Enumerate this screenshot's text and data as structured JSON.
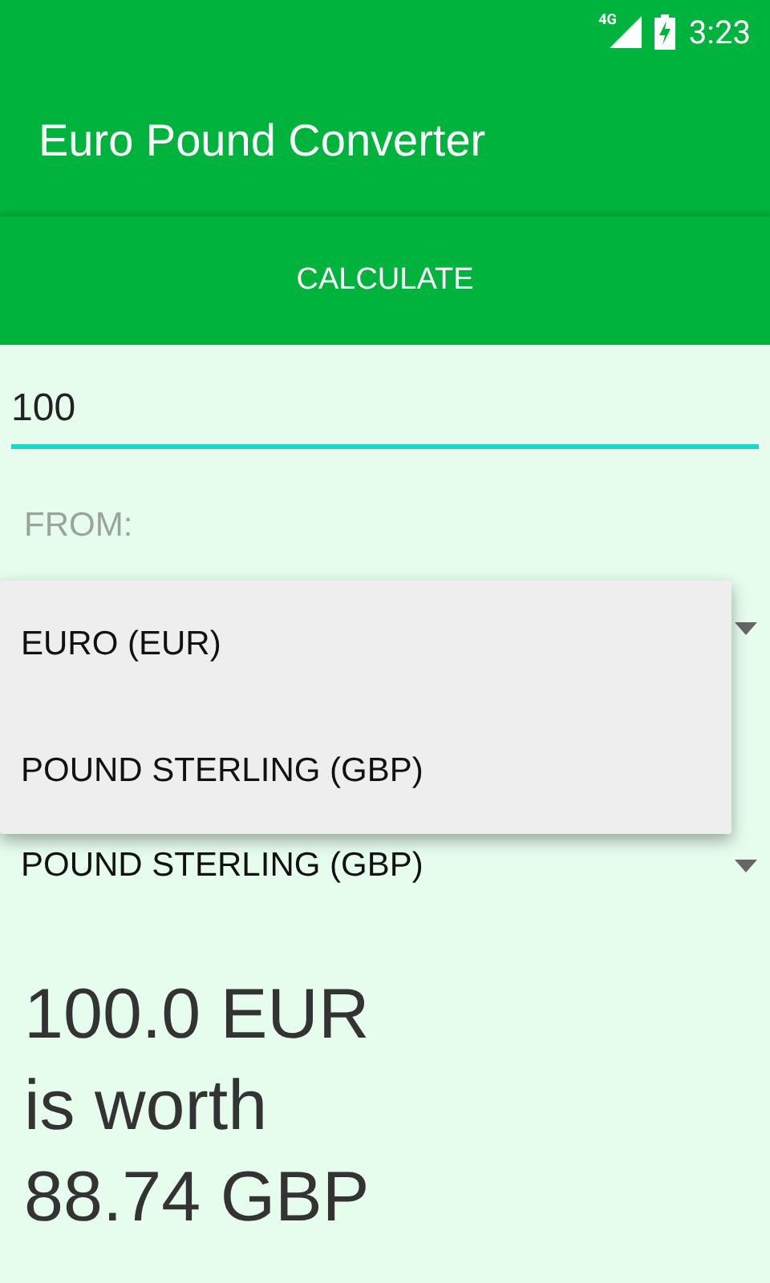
{
  "status_bar": {
    "network": "4G",
    "time": "3:23"
  },
  "app_bar": {
    "title": "Euro Pound Converter"
  },
  "calculate_button": {
    "label": "CALCULATE"
  },
  "amount_field": {
    "value": "100"
  },
  "from_label": "FROM:",
  "from_spinner": {
    "expanded": true
  },
  "dropdown_menu": {
    "options": [
      {
        "label": "EURO (EUR)"
      },
      {
        "label": "POUND STERLING (GBP)"
      }
    ]
  },
  "to_spinner": {
    "value": "POUND STERLING (GBP)"
  },
  "result": {
    "lines": [
      "100.0 EUR",
      "is worth",
      "88.74 GBP"
    ]
  }
}
